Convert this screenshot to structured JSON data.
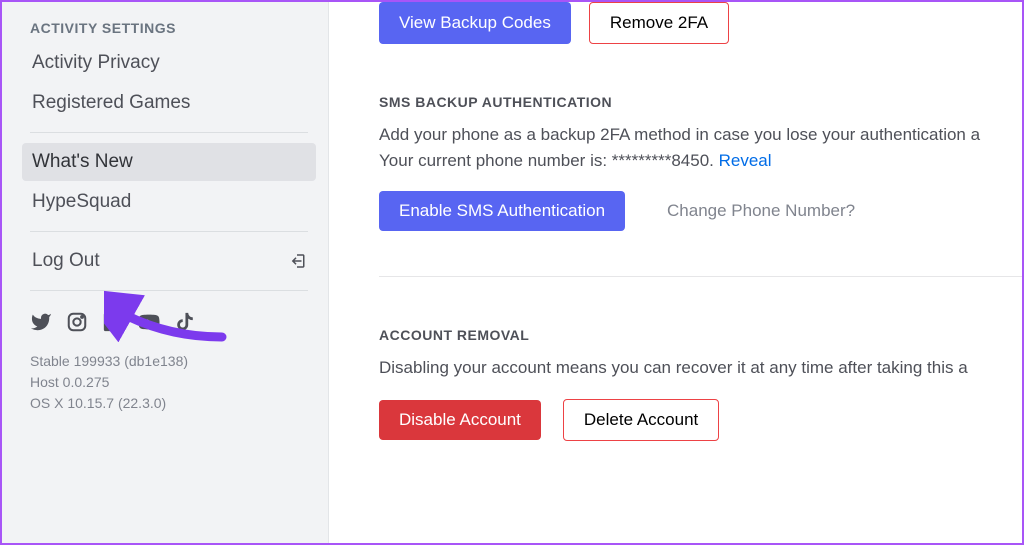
{
  "sidebar": {
    "header": "ACTIVITY SETTINGS",
    "items": [
      {
        "label": "Activity Privacy"
      },
      {
        "label": "Registered Games"
      }
    ],
    "secondary": [
      {
        "label": "What's New",
        "selected": true
      },
      {
        "label": "HypeSquad"
      }
    ],
    "logout": "Log Out",
    "version": {
      "line1": "Stable 199933 (db1e138)",
      "line2": "Host 0.0.275",
      "line3": "OS X 10.15.7 (22.3.0)"
    }
  },
  "main": {
    "top": {
      "view_backup": "View Backup Codes",
      "remove_2fa": "Remove 2FA"
    },
    "sms": {
      "title": "SMS BACKUP AUTHENTICATION",
      "desc_line1": "Add your phone as a backup 2FA method in case you lose your authentication a",
      "desc_line2_prefix": "Your current phone number is: *********8450. ",
      "reveal": "Reveal",
      "enable_btn": "Enable SMS Authentication",
      "change_btn": "Change Phone Number?"
    },
    "removal": {
      "title": "ACCOUNT REMOVAL",
      "desc": "Disabling your account means you can recover it at any time after taking this a",
      "disable_btn": "Disable Account",
      "delete_btn": "Delete Account"
    }
  }
}
